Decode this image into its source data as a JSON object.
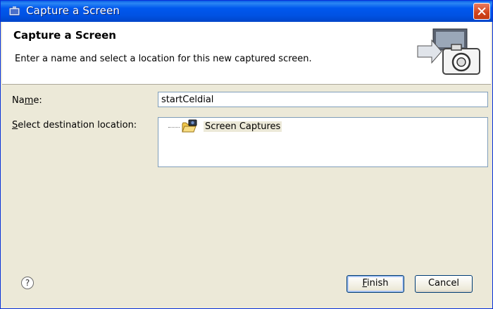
{
  "window": {
    "title": "Capture a Screen"
  },
  "banner": {
    "title": "Capture a Screen",
    "description": "Enter a name and select a location for this new captured screen."
  },
  "form": {
    "name_label_pre": "Na",
    "name_label_mnemonic": "m",
    "name_label_post": "e:",
    "name_value": "startCeldial",
    "dest_label_mnemonic": "S",
    "dest_label_post": "elect destination location:",
    "tree_items": [
      "Screen Captures"
    ]
  },
  "footer": {
    "help_glyph": "?",
    "finish_mnemonic": "F",
    "finish_post": "inish",
    "cancel_label": "Cancel"
  },
  "colors": {
    "titlebar": "#0054e3",
    "dialog_bg": "#ece9d8",
    "close": "#d1441b"
  },
  "icons": [
    "app-icon",
    "close-icon",
    "camera-capture-icon",
    "folder-camera-icon",
    "help-icon"
  ]
}
